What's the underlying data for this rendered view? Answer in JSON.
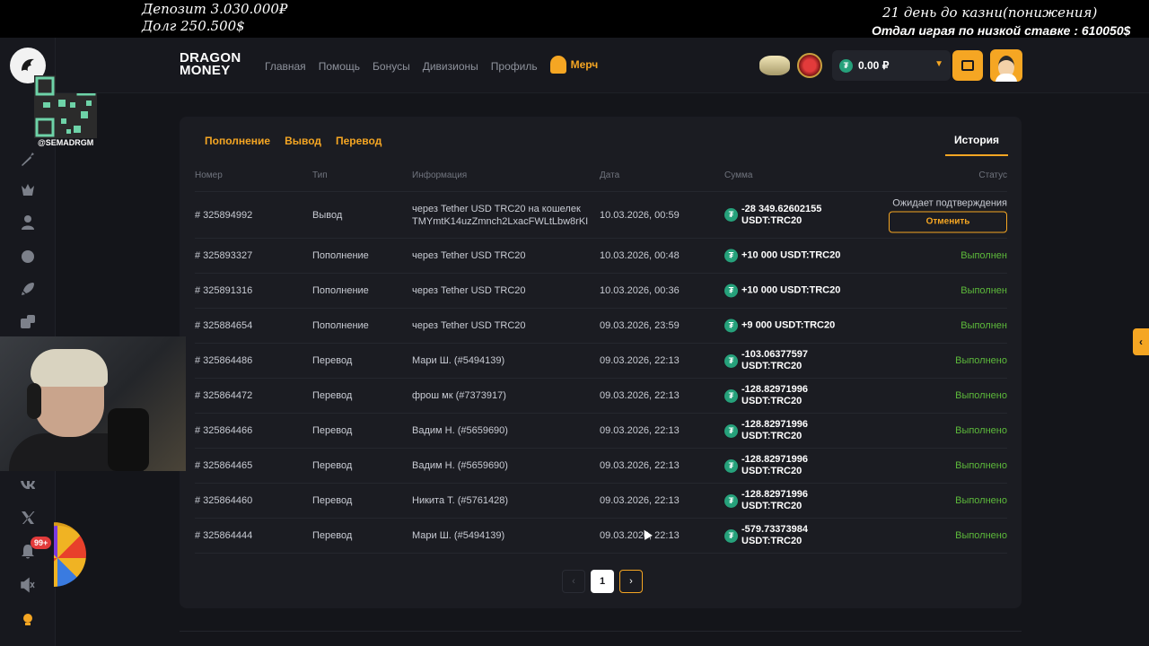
{
  "overlay": {
    "deposit": "Депозит 3.030.000₽",
    "debt": "Долг  250.500$",
    "days": "21 день до казни(понижения)",
    "given": "Отдал играя по низкой ставке : 610050$"
  },
  "sidebar": {
    "handle": "@SEMADRGM",
    "notif_badge": "99+"
  },
  "header": {
    "brand_line1": "DRAGON",
    "brand_line2": "MONEY",
    "nav": [
      "Главная",
      "Помощь",
      "Бонусы",
      "Дивизионы",
      "Профиль"
    ],
    "merch": "Мерч",
    "balance": "0.00 ₽",
    "coin_symbol": "₮"
  },
  "tabs": {
    "deposit": "Пополнение",
    "withdraw": "Вывод",
    "transfer": "Перевод",
    "history": "История"
  },
  "table": {
    "headers": {
      "number": "Номер",
      "type": "Тип",
      "info": "Информация",
      "date": "Дата",
      "amount": "Сумма",
      "status": "Статус"
    },
    "rows": [
      {
        "number": "# 325894992",
        "type": "Вывод",
        "info1": "через Tether USD TRC20 на кошелек",
        "info2": "TMYmtK14uzZmnch2LxacFWLtLbw8rKI",
        "date": "10.03.2026, 00:59",
        "amount1": "-28 349.62602155",
        "amount2": "USDT:TRC20",
        "status": "Ожидает подтверждения",
        "action": "Отменить"
      },
      {
        "number": "# 325893327",
        "type": "Пополнение",
        "info1": "через Tether USD TRC20",
        "date": "10.03.2026, 00:48",
        "amount1": "+10 000 USDT:TRC20",
        "status": "Выполнен"
      },
      {
        "number": "# 325891316",
        "type": "Пополнение",
        "info1": "через Tether USD TRC20",
        "date": "10.03.2026, 00:36",
        "amount1": "+10 000 USDT:TRC20",
        "status": "Выполнен"
      },
      {
        "number": "# 325884654",
        "type": "Пополнение",
        "info1": "через Tether USD TRC20",
        "date": "09.03.2026, 23:59",
        "amount1": "+9 000 USDT:TRC20",
        "status": "Выполнен"
      },
      {
        "number": "# 325864486",
        "type": "Перевод",
        "info1": "Мари Ш. (#5494139)",
        "date": "09.03.2026, 22:13",
        "amount1": "-103.06377597",
        "amount2": "USDT:TRC20",
        "status": "Выполнено"
      },
      {
        "number": "# 325864472",
        "type": "Перевод",
        "info1": "фрош мк (#7373917)",
        "date": "09.03.2026, 22:13",
        "amount1": "-128.82971996",
        "amount2": "USDT:TRC20",
        "status": "Выполнено"
      },
      {
        "number": "# 325864466",
        "type": "Перевод",
        "info1": "Вадим Н. (#5659690)",
        "date": "09.03.2026, 22:13",
        "amount1": "-128.82971996",
        "amount2": "USDT:TRC20",
        "status": "Выполнено"
      },
      {
        "number": "# 325864465",
        "type": "Перевод",
        "info1": "Вадим Н. (#5659690)",
        "date": "09.03.2026, 22:13",
        "amount1": "-128.82971996",
        "amount2": "USDT:TRC20",
        "status": "Выполнено"
      },
      {
        "number": "# 325864460",
        "type": "Перевод",
        "info1": "Никита Т. (#5761428)",
        "date": "09.03.2026, 22:13",
        "amount1": "-128.82971996",
        "amount2": "USDT:TRC20",
        "status": "Выполнено"
      },
      {
        "number": "# 325864444",
        "type": "Перевод",
        "info1": "Мари Ш. (#5494139)",
        "date": "09.03.2026, 22:13",
        "amount1": "-579.73373984",
        "amount2": "USDT:TRC20",
        "status": "Выполнено"
      }
    ]
  },
  "pagination": {
    "prev": "‹",
    "current": "1",
    "next": "›"
  },
  "colors": {
    "accent": "#f5a623",
    "success": "#5dba3b",
    "background": "#14151a",
    "card": "#1b1c22"
  }
}
